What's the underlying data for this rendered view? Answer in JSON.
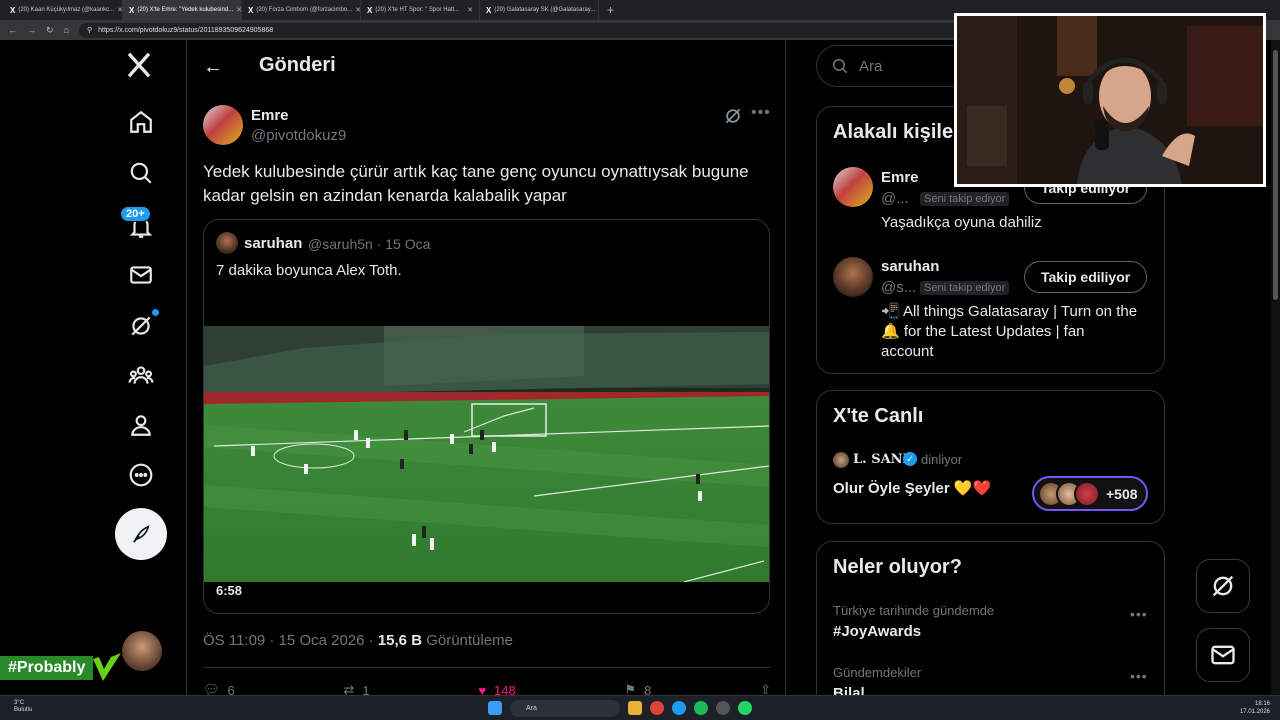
{
  "browser": {
    "tabs": [
      {
        "title": "(20) Kaan Küçükyılmaz (@kaankc...",
        "active": false
      },
      {
        "title": "(20) X'te Emre: \"Yedek kulubesind...",
        "active": true
      },
      {
        "title": "(20) Forza Cimbom (@forzacimbo...",
        "active": false
      },
      {
        "title": "(20) X'te HT Spor: \" Spor Hatt...",
        "active": false
      },
      {
        "title": "(20) Galatasaray SK (@Galatasaray...",
        "active": false
      }
    ],
    "url": "https://x.com/pivotdokuz9/status/2011893509624905868"
  },
  "nav": {
    "notifications_badge": "20+"
  },
  "header": {
    "title": "Gönderi"
  },
  "tweet": {
    "author_name": "Emre",
    "author_handle": "@pivotdokuz9",
    "text": "Yedek kulubesinde çürür artık kaç tane genç oyuncu oynattıysak bugune kadar gelsin en azindan kenarda kalabalik yapar",
    "quote": {
      "name": "saruhan",
      "meta": "@saruh5n · 15 Oca",
      "text": "7 dakika boyunca Alex Toth.",
      "video_duration": "6:58"
    },
    "timestamp": "ÖS 11:09 · 15 Oca 2026 · ",
    "views_count": "15,6 B",
    "views_label": "Görüntüleme",
    "actions": {
      "replies": "6",
      "reposts": "1",
      "likes": "148",
      "bookmarks": "8"
    }
  },
  "search": {
    "placeholder": "Ara"
  },
  "related": {
    "title": "Alakalı kişiler",
    "people": [
      {
        "name": "Emre",
        "handle": "@...",
        "follows_you": "Seni takip ediyor",
        "button": "Takip ediliyor",
        "bio": "Yaşadıkça oyuna dahiliz"
      },
      {
        "name": "saruhan",
        "handle": "@s...",
        "follows_you": "Seni takip ediyor",
        "button": "Takip ediliyor",
        "bio_line1": "📲 All things Galatasaray | Turn on the",
        "bio_line2": "🔔 for the Latest Updates | fan",
        "bio_line3": "account"
      }
    ]
  },
  "live": {
    "title": "X'te Canlı",
    "host": "L. SANE",
    "host_status": "dinliyor",
    "space_title": "Olur Öyle Şeyler 💛❤️",
    "listeners": "+508"
  },
  "trends": {
    "title": "Neler oluyor?",
    "items": [
      {
        "context": "Türkiye tarihinde gündemde",
        "name": "#JoyAwards"
      },
      {
        "context": "Gündemdekiler",
        "name": "Bilal"
      }
    ]
  },
  "overlay": {
    "tag": "#Probably"
  },
  "taskbar": {
    "weather_temp": "3°C",
    "weather_desc": "Bulutlu",
    "search": "Ara",
    "time": "18:16",
    "date": "17.01.2026"
  },
  "colors": {
    "accent": "#1d9bf0",
    "like": "#f91880",
    "live_border": "#7856ff",
    "background": "#000000"
  }
}
